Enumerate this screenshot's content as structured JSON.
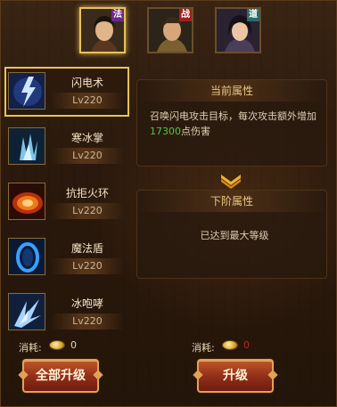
{
  "classes": [
    {
      "name": "法",
      "color": "#6a2a8c",
      "active": true
    },
    {
      "name": "战",
      "color": "#a21f1f",
      "active": false
    },
    {
      "name": "道",
      "color": "#2a6c6c",
      "active": false
    }
  ],
  "skills": [
    {
      "name": "闪电术",
      "level": "Lv220",
      "icon": "lightning-icon",
      "selected": true
    },
    {
      "name": "寒冰掌",
      "level": "Lv220",
      "icon": "ice-palm-icon",
      "selected": false
    },
    {
      "name": "抗拒火环",
      "level": "Lv220",
      "icon": "fire-ring-icon",
      "selected": false
    },
    {
      "name": "魔法盾",
      "level": "Lv220",
      "icon": "magic-shield-icon",
      "selected": false
    },
    {
      "name": "冰咆哮",
      "level": "Lv220",
      "icon": "ice-roar-icon",
      "selected": false
    }
  ],
  "current_attr": {
    "title": "当前属性",
    "desc_pre": "召唤闪电攻击目标，每次攻击额外增加",
    "desc_value": "17300",
    "desc_post": "点伤害"
  },
  "next_attr": {
    "title": "下阶属性",
    "desc": "已达到最大等级"
  },
  "footer": {
    "left_cost_label": "消耗:",
    "left_cost_value": "0",
    "right_cost_label": "消耗:",
    "right_cost_value": "0",
    "upgrade_all_label": "全部升级",
    "upgrade_label": "升级"
  }
}
